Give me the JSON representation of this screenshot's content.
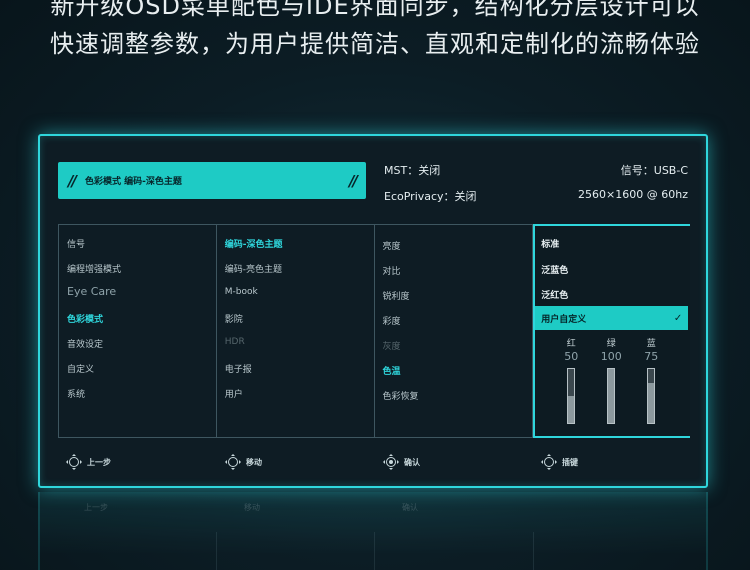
{
  "headline": {
    "line1": "新升级OSD菜单配色与IDE界面同步，结构化分层设计可以",
    "line2": "快速调整参数，为用户提供简洁、直观和定制化的流畅体验"
  },
  "osd": {
    "mode_banner": {
      "icon_left": "//",
      "label": "色彩模式 编码-深色主题",
      "icon_right": "//"
    },
    "status": {
      "mst": "MST：关闭",
      "eco": "EcoPrivacy：关闭",
      "signal": "信号：USB-C",
      "resolution": "2560×1600 @ 60hz"
    },
    "col1": [
      "信号",
      "编程增强模式",
      "Eye Care",
      "色彩模式",
      "音效设定",
      "自定义",
      "系统"
    ],
    "col2": [
      "编码-深色主题",
      "编码-亮色主题",
      "M-book",
      "影院",
      "HDR",
      "电子报",
      "用户"
    ],
    "col3": [
      "亮度",
      "对比",
      "锐利度",
      "彩度",
      "灰度",
      "色温",
      "色彩恢复"
    ],
    "col4": {
      "options": [
        "标准",
        "泛蓝色",
        "泛红色"
      ],
      "selected": "用户自定义",
      "check": "✓",
      "sliders": [
        {
          "label": "红",
          "value": "50",
          "level": 0.5
        },
        {
          "label": "绿",
          "value": "100",
          "level": 1.0
        },
        {
          "label": "蓝",
          "value": "75",
          "level": 0.75
        }
      ]
    },
    "footer": [
      "上一步",
      "移动",
      "确认",
      "插键"
    ]
  },
  "reflection": [
    "上一步",
    "移动",
    "确认"
  ],
  "colors": {
    "accent": "#1ecbc5",
    "border_glow": "#2fd6dc",
    "background": "#0b1a22"
  }
}
